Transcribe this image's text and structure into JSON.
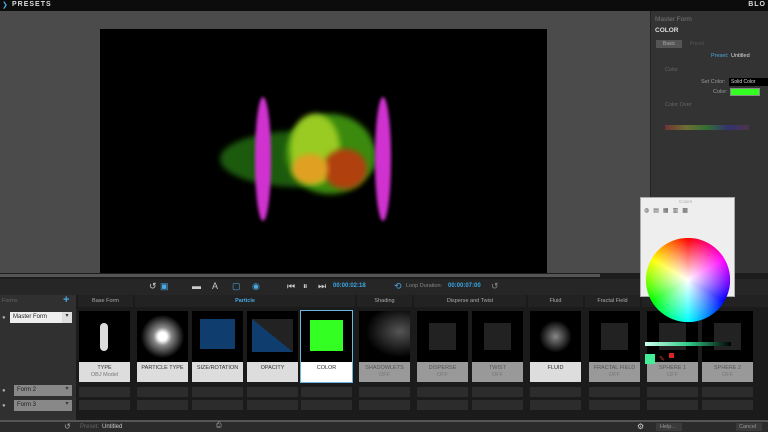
{
  "topbar": {
    "title": "PRESETS",
    "right_title": "BLO"
  },
  "right_panel": {
    "form": "Master Form",
    "section": "COLOR",
    "tabs": [
      "Basic",
      "Preset"
    ],
    "preset_label": "Preset:",
    "preset_value": "Untitled",
    "group": "Color",
    "set_color_label": "Set Color:",
    "set_color_value": "Solid Color",
    "color_label": "Color:",
    "color_value": "#33ff22",
    "color_over_label": "Color Over"
  },
  "toolbar": {
    "current_time": "00:00:02:18",
    "loop_label": "Loop Duration:",
    "loop_time": "00:00:07:00"
  },
  "forms": {
    "header": "Forms",
    "items": [
      "Master Form",
      "Form 2",
      "Form 3"
    ]
  },
  "sections": [
    "Base Form",
    "Particle",
    "Shading",
    "Disperse and Twist",
    "Fluid",
    "Fractal Field"
  ],
  "tiles": [
    {
      "label": "TYPE",
      "sub": "OBJ Model"
    },
    {
      "label": "PARTICLE TYPE",
      "sub": ""
    },
    {
      "label": "SIZE/ROTATION",
      "sub": ""
    },
    {
      "label": "OPACITY",
      "sub": ""
    },
    {
      "label": "COLOR",
      "sub": ""
    },
    {
      "label": "SHADOWLETS",
      "sub": "OFF"
    },
    {
      "label": "DISPERSE",
      "sub": "OFF"
    },
    {
      "label": "TWIST",
      "sub": "OFF"
    },
    {
      "label": "FLUID",
      "sub": ""
    },
    {
      "label": "FRACTAL FIELD",
      "sub": "OFF"
    },
    {
      "label": "SPHERE 1",
      "sub": "OFF"
    },
    {
      "label": "SPHERE 2",
      "sub": "OFF"
    }
  ],
  "picker": {
    "title": "Colors",
    "swatch": "#44ee99"
  },
  "status": {
    "preset_label": "Preset:",
    "preset_value": "Untitled",
    "help": "Help...",
    "cancel": "Cancel"
  }
}
